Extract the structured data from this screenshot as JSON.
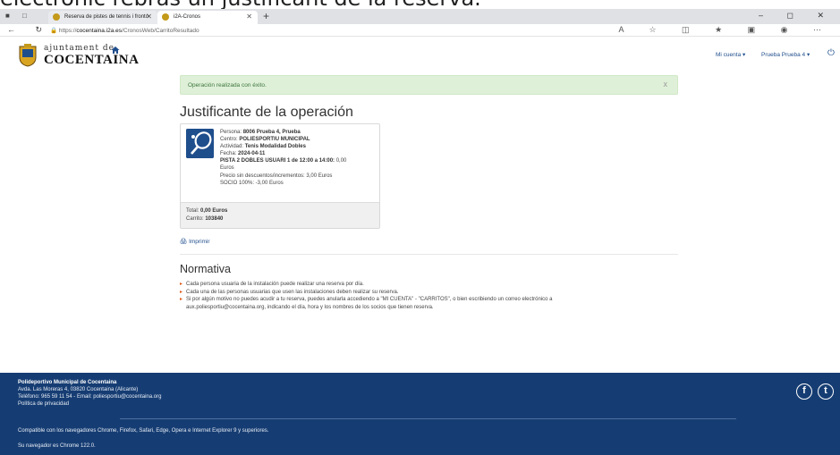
{
  "top_caption": "electrònic rebràs un justificant de la reserva.",
  "browser": {
    "tabs": [
      {
        "label": "Reserva de pistes de tennis i frontó"
      },
      {
        "label": "i2A-Cronos"
      }
    ],
    "url_prefix": "https://",
    "url_host": "cocentaina.i2a.es",
    "url_path": "/CronosWeb/CarritoResultado"
  },
  "header": {
    "logo_line1": "ajuntament de",
    "logo_line2": "COCENTAINA",
    "account_menu": "Mi cuenta ▾",
    "user_menu": "Prueba Prueba 4 ▾"
  },
  "alert": {
    "message": "Operación realizada con éxito.",
    "close": "x"
  },
  "page_title": "Justificante de la operación",
  "receipt": {
    "persona_label": "Persona:",
    "persona_value": "8006 Prueba 4, Prueba",
    "centro_label": "Centro:",
    "centro_value": "POLIESPORTIU MUNICIPAL",
    "actividad_label": "Actividad:",
    "actividad_value": "Tenis Modalidad Dobles",
    "fecha_label": "Fecha:",
    "fecha_value": "2024-04-11",
    "pista_value": "PISTA 2 DOBLES USUARI 1 de 12:00 a 14:00:",
    "pista_price": "0,00",
    "pista_unit": "Euros",
    "precio_line": "Precio sin descuentos/incrementos: 3,00 Euros",
    "socio_line": "SOCIO 100%: -3,00 Euros",
    "total_label": "Total:",
    "total_value": "0,00 Euros",
    "carrito_label": "Carrito:",
    "carrito_value": "103840"
  },
  "print_label": "Imprimir",
  "normativa": {
    "title": "Normativa",
    "rules": [
      "Cada persona usuaria de la instalación puede realizar una reserva por día.",
      "Cada una de las personas usuarias que usen las instalaciones deben realizar su reserva.",
      "Si por algún motivo no puedes acudir a tu reserva, puedes anularla accediendo a \"MI CUENTA\" - \"CARRITOS\", o bien escribiendo un correo electrónico a",
      "aux.poliesportiu@cocentaina.org, indicando el día, hora y los nombres de los socios que tienen reserva."
    ]
  },
  "footer": {
    "name": "Polideportivo Municipal de Cocentaina",
    "address": "Avda. Las Moreras 4, 03820 Cocentaina (Alicante)",
    "contact": "Teléfono: 965 59 11 54 - Email: poliesportiu@cocentaina.org",
    "privacy": "Política de privacidad",
    "compat": "Compatible con los navegadores Chrome, Firefox, Safari, Edge, Opera e Internet Explorer 9 y superiores.",
    "browser_info": "Su navegador es Chrome 122.0.",
    "facebook_glyph": "f",
    "twitter_glyph": "t"
  },
  "colors": {
    "brand_blue": "#1f4e8c",
    "footer_blue": "#163d73",
    "alert_green_bg": "#dff0d8",
    "bullet_orange": "#e05c1a"
  }
}
